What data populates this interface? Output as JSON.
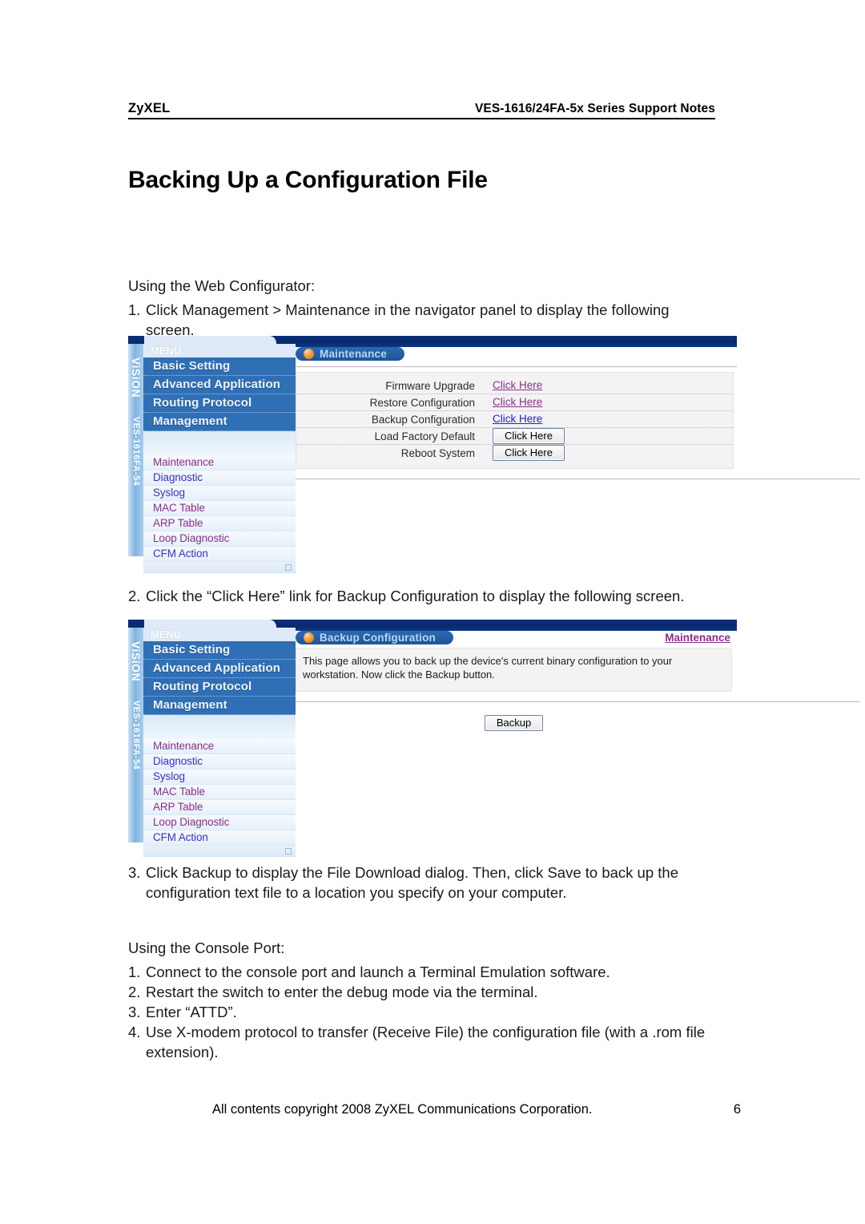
{
  "doc": {
    "header": {
      "brand": "ZyXEL",
      "series": "VES-1616/24FA-5x Series Support Notes"
    },
    "title": "Backing Up a Configuration File",
    "intro_web": "Using the Web Configurator:",
    "steps_web": [
      {
        "num": "1.",
        "text": "Click Management > Maintenance in the navigator panel to display the following screen."
      },
      {
        "num": "2.",
        "text": "Click the “Click Here” link for Backup Configuration to display the following screen."
      },
      {
        "num": "3.",
        "text": "Click Backup to display the File Download dialog. Then, click Save to back up the configuration text file to a location you specify on your computer."
      }
    ],
    "intro_console": "Using the Console Port:",
    "steps_console": [
      {
        "num": "1.",
        "text": "Connect to the console port and launch a Terminal Emulation software."
      },
      {
        "num": "2.",
        "text": "Restart the switch to enter the debug mode via the terminal."
      },
      {
        "num": "3.",
        "text": "Enter “ATTD”."
      },
      {
        "num": "4.",
        "text": "Use X-modem protocol to transfer (Receive File) the configuration file (with a .rom file extension)."
      }
    ],
    "footer": {
      "copyright": "All contents copyright 2008 ZyXEL Communications Corporation.",
      "page_number": "6"
    }
  },
  "device_ui": {
    "brand_strip": {
      "vision": "ViSiON",
      "model": "VES-1616FA-54"
    },
    "nav": {
      "menu_label": "MENU",
      "top_items": [
        "Basic Setting",
        "Advanced Application",
        "Routing Protocol",
        "Management"
      ],
      "sub_items": [
        {
          "label": "Maintenance",
          "color": "purple"
        },
        {
          "label": "Diagnostic",
          "color": "blue"
        },
        {
          "label": "Syslog",
          "color": "blue"
        },
        {
          "label": "MAC Table",
          "color": "purple"
        },
        {
          "label": "ARP Table",
          "color": "purple"
        },
        {
          "label": "Loop Diagnostic",
          "color": "purple"
        },
        {
          "label": "CFM Action",
          "color": "blue"
        }
      ]
    },
    "maintenance_screen": {
      "title": "Maintenance",
      "rows": [
        {
          "label": "Firmware Upgrade",
          "action": "Click Here",
          "type": "link",
          "link_color": "purple"
        },
        {
          "label": "Restore Configuration",
          "action": "Click Here",
          "type": "link",
          "link_color": "purple"
        },
        {
          "label": "Backup Configuration",
          "action": "Click Here",
          "type": "link",
          "link_color": "blue"
        },
        {
          "label": "Load Factory Default",
          "action": "Click Here",
          "type": "button",
          "link_color": ""
        },
        {
          "label": "Reboot System",
          "action": "Click Here",
          "type": "button",
          "link_color": ""
        }
      ]
    },
    "backup_screen": {
      "title": "Backup Configuration",
      "breadcrumb_link": "Maintenance",
      "note": "This page allows you to back up the device's current binary configuration to your workstation. Now click the Backup button.",
      "backup_button": "Backup"
    },
    "colors": {
      "nav_top_blue": "#2f6fb5",
      "topbar_navy": "#0b2f7a",
      "pill_blue": "#1d5699",
      "orb_orange": "#f79a36",
      "link_purple": "#8b2f8b",
      "link_blue": "#2222cc"
    }
  }
}
